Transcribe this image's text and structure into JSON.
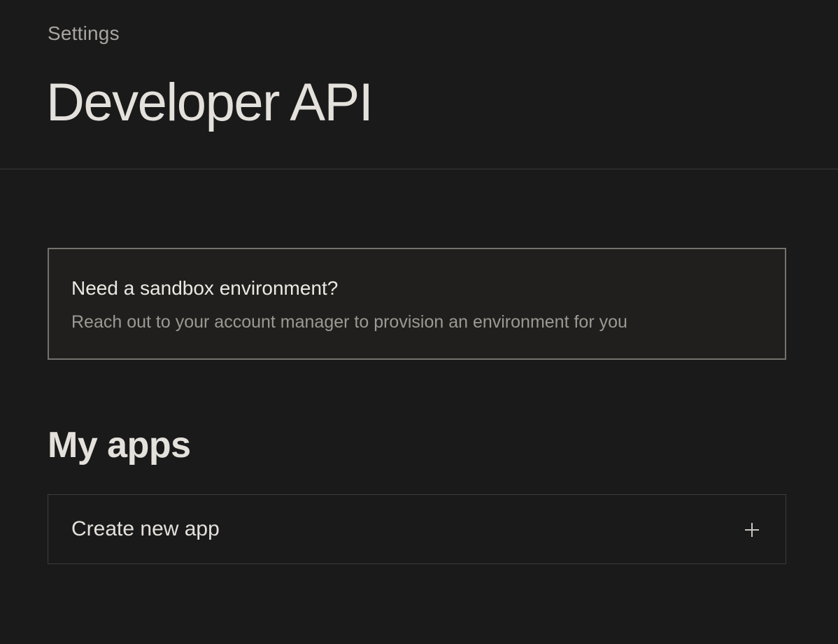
{
  "header": {
    "breadcrumb": "Settings",
    "title": "Developer API"
  },
  "sandbox_notice": {
    "title": "Need a sandbox environment?",
    "description": "Reach out to your account manager to provision an environment for you"
  },
  "apps": {
    "section_title": "My apps",
    "create_label": "Create new app",
    "create_icon": "plus-icon"
  },
  "colors": {
    "background": "#1a1a1a",
    "card_background": "#201f1d",
    "text_primary": "#e4e1dc",
    "text_secondary": "#9c9994",
    "border_strong": "#75726e",
    "border_subtle": "#3c3c3c"
  }
}
